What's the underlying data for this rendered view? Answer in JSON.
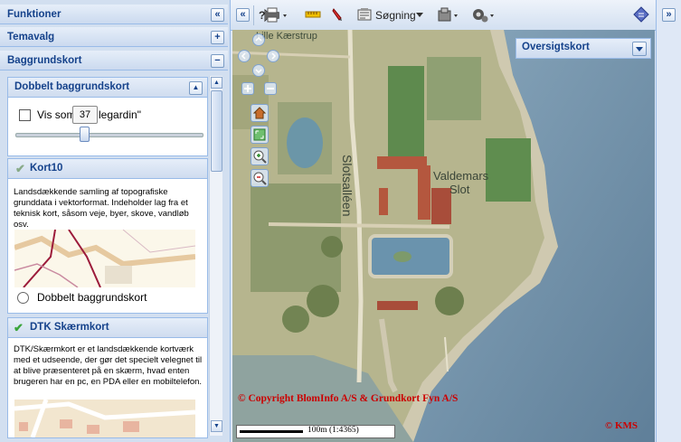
{
  "left": {
    "sections": [
      {
        "label": "Funktioner",
        "btn": "«"
      },
      {
        "label": "Temavalg",
        "btn": "+"
      },
      {
        "label": "Baggrundskort",
        "btn": "−"
      }
    ],
    "dobbelt": {
      "title": "Dobbelt baggrundskort",
      "btn": "▲",
      "checkbox_label_pre": "Vis som",
      "checkbox_label_post": "legardin\"",
      "slider_value": "37"
    },
    "layers": [
      {
        "title": "Kort10",
        "description": "Landsdækkende samling af topografiske grunddata i vektorformat. Indeholder lag fra et teknisk kort, såsom veje, byer, skove, vandløb osv.",
        "radio_label": "Dobbelt baggrundskort"
      },
      {
        "title": "DTK Skærmkort",
        "description": "DTK/Skærmkort er et landsdækkende kortværk med et udseende, der gør det specielt velegnet til at blive præsenteret på en skærm, hvad enten brugeren har en pc, en PDA eller en mobiltelefon."
      }
    ],
    "scroll_up": "▲",
    "scroll_down": "▼"
  },
  "toolbar": {
    "search_label": "Søgning",
    "collapse": "«"
  },
  "map": {
    "overview_label": "Oversigtskort",
    "labels": {
      "lille": "Lille Kærstrup",
      "slotsalleen": "Slotsalléen",
      "valdemars": "Valdemars",
      "slot": "Slot"
    },
    "copyright": "© Copyright BlomInfo A/S & Grundkort Fyn A/S",
    "kms": "© KMS",
    "scale": "100m (1:4365)"
  },
  "colors": {
    "header_text": "#15428b",
    "copyright_red": "#cc0000",
    "sea": "#6f8ea6"
  }
}
